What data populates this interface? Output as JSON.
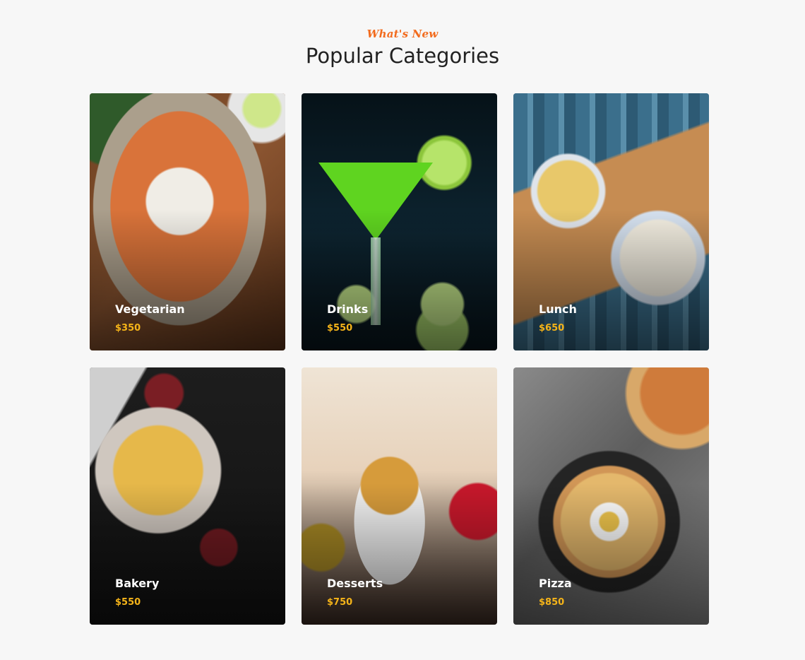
{
  "header": {
    "eyebrow": "What's New",
    "title": "Popular Categories"
  },
  "categories": [
    {
      "name": "Vegetarian",
      "price": "$350",
      "image": "vegetarian-food-image"
    },
    {
      "name": "Drinks",
      "price": "$550",
      "image": "cocktail-image"
    },
    {
      "name": "Lunch",
      "price": "$650",
      "image": "lunch-table-image"
    },
    {
      "name": "Bakery",
      "price": "$550",
      "image": "pie-image"
    },
    {
      "name": "Desserts",
      "price": "$750",
      "image": "dessert-jar-image"
    },
    {
      "name": "Pizza",
      "price": "$850",
      "image": "pizza-image"
    }
  ],
  "colors": {
    "accent": "#f26b1d",
    "price": "#f5b419",
    "title": "#222222",
    "background": "#f7f7f7"
  }
}
